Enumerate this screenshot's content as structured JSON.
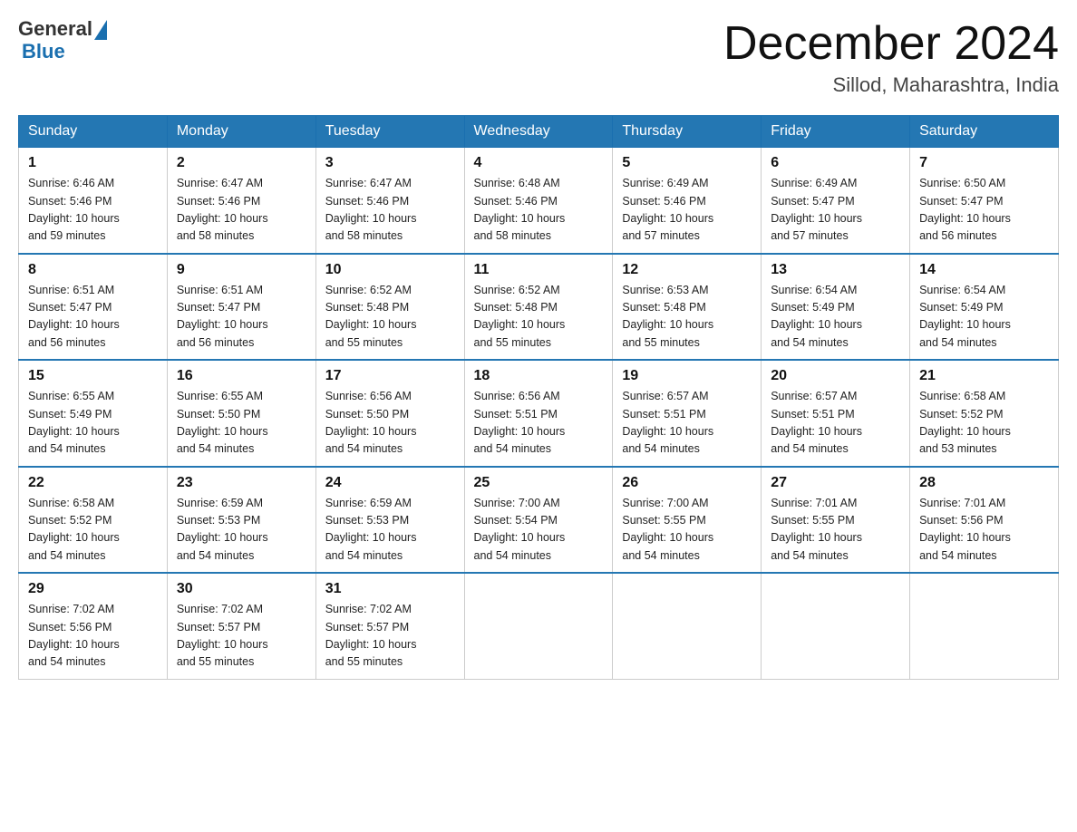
{
  "header": {
    "logo_line1": "General",
    "logo_line2": "Blue",
    "month": "December 2024",
    "location": "Sillod, Maharashtra, India"
  },
  "days_of_week": [
    "Sunday",
    "Monday",
    "Tuesday",
    "Wednesday",
    "Thursday",
    "Friday",
    "Saturday"
  ],
  "weeks": [
    [
      {
        "day": "1",
        "sunrise": "6:46 AM",
        "sunset": "5:46 PM",
        "daylight": "10 hours and 59 minutes."
      },
      {
        "day": "2",
        "sunrise": "6:47 AM",
        "sunset": "5:46 PM",
        "daylight": "10 hours and 58 minutes."
      },
      {
        "day": "3",
        "sunrise": "6:47 AM",
        "sunset": "5:46 PM",
        "daylight": "10 hours and 58 minutes."
      },
      {
        "day": "4",
        "sunrise": "6:48 AM",
        "sunset": "5:46 PM",
        "daylight": "10 hours and 58 minutes."
      },
      {
        "day": "5",
        "sunrise": "6:49 AM",
        "sunset": "5:46 PM",
        "daylight": "10 hours and 57 minutes."
      },
      {
        "day": "6",
        "sunrise": "6:49 AM",
        "sunset": "5:47 PM",
        "daylight": "10 hours and 57 minutes."
      },
      {
        "day": "7",
        "sunrise": "6:50 AM",
        "sunset": "5:47 PM",
        "daylight": "10 hours and 56 minutes."
      }
    ],
    [
      {
        "day": "8",
        "sunrise": "6:51 AM",
        "sunset": "5:47 PM",
        "daylight": "10 hours and 56 minutes."
      },
      {
        "day": "9",
        "sunrise": "6:51 AM",
        "sunset": "5:47 PM",
        "daylight": "10 hours and 56 minutes."
      },
      {
        "day": "10",
        "sunrise": "6:52 AM",
        "sunset": "5:48 PM",
        "daylight": "10 hours and 55 minutes."
      },
      {
        "day": "11",
        "sunrise": "6:52 AM",
        "sunset": "5:48 PM",
        "daylight": "10 hours and 55 minutes."
      },
      {
        "day": "12",
        "sunrise": "6:53 AM",
        "sunset": "5:48 PM",
        "daylight": "10 hours and 55 minutes."
      },
      {
        "day": "13",
        "sunrise": "6:54 AM",
        "sunset": "5:49 PM",
        "daylight": "10 hours and 54 minutes."
      },
      {
        "day": "14",
        "sunrise": "6:54 AM",
        "sunset": "5:49 PM",
        "daylight": "10 hours and 54 minutes."
      }
    ],
    [
      {
        "day": "15",
        "sunrise": "6:55 AM",
        "sunset": "5:49 PM",
        "daylight": "10 hours and 54 minutes."
      },
      {
        "day": "16",
        "sunrise": "6:55 AM",
        "sunset": "5:50 PM",
        "daylight": "10 hours and 54 minutes."
      },
      {
        "day": "17",
        "sunrise": "6:56 AM",
        "sunset": "5:50 PM",
        "daylight": "10 hours and 54 minutes."
      },
      {
        "day": "18",
        "sunrise": "6:56 AM",
        "sunset": "5:51 PM",
        "daylight": "10 hours and 54 minutes."
      },
      {
        "day": "19",
        "sunrise": "6:57 AM",
        "sunset": "5:51 PM",
        "daylight": "10 hours and 54 minutes."
      },
      {
        "day": "20",
        "sunrise": "6:57 AM",
        "sunset": "5:51 PM",
        "daylight": "10 hours and 54 minutes."
      },
      {
        "day": "21",
        "sunrise": "6:58 AM",
        "sunset": "5:52 PM",
        "daylight": "10 hours and 53 minutes."
      }
    ],
    [
      {
        "day": "22",
        "sunrise": "6:58 AM",
        "sunset": "5:52 PM",
        "daylight": "10 hours and 54 minutes."
      },
      {
        "day": "23",
        "sunrise": "6:59 AM",
        "sunset": "5:53 PM",
        "daylight": "10 hours and 54 minutes."
      },
      {
        "day": "24",
        "sunrise": "6:59 AM",
        "sunset": "5:53 PM",
        "daylight": "10 hours and 54 minutes."
      },
      {
        "day": "25",
        "sunrise": "7:00 AM",
        "sunset": "5:54 PM",
        "daylight": "10 hours and 54 minutes."
      },
      {
        "day": "26",
        "sunrise": "7:00 AM",
        "sunset": "5:55 PM",
        "daylight": "10 hours and 54 minutes."
      },
      {
        "day": "27",
        "sunrise": "7:01 AM",
        "sunset": "5:55 PM",
        "daylight": "10 hours and 54 minutes."
      },
      {
        "day": "28",
        "sunrise": "7:01 AM",
        "sunset": "5:56 PM",
        "daylight": "10 hours and 54 minutes."
      }
    ],
    [
      {
        "day": "29",
        "sunrise": "7:02 AM",
        "sunset": "5:56 PM",
        "daylight": "10 hours and 54 minutes."
      },
      {
        "day": "30",
        "sunrise": "7:02 AM",
        "sunset": "5:57 PM",
        "daylight": "10 hours and 55 minutes."
      },
      {
        "day": "31",
        "sunrise": "7:02 AM",
        "sunset": "5:57 PM",
        "daylight": "10 hours and 55 minutes."
      },
      null,
      null,
      null,
      null
    ]
  ]
}
